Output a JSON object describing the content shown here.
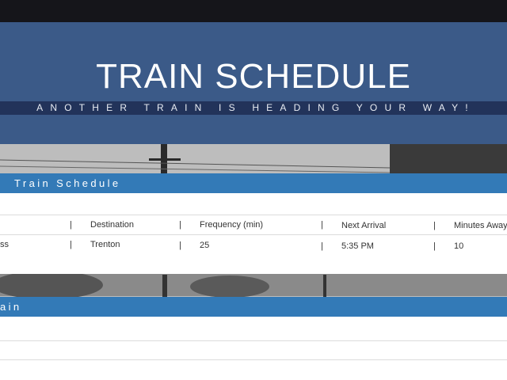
{
  "hero": {
    "title": "TRAIN SCHEDULE",
    "tagline": "ANOTHER TRAIN IS HEADING YOUR WAY!"
  },
  "schedule_panel": {
    "heading": "Train Schedule",
    "columns": [
      "",
      "Destination",
      "Frequency (min)",
      "Next Arrival",
      "Minutes Away"
    ],
    "rows": [
      [
        "ss",
        "Trenton",
        "25",
        "5:35 PM",
        "10"
      ]
    ]
  },
  "add_panel": {
    "heading": "ain"
  },
  "colors": {
    "hero_bg": "#3b5a88",
    "tagline_band": "#22335a",
    "panel_heading": "#337ab7"
  }
}
